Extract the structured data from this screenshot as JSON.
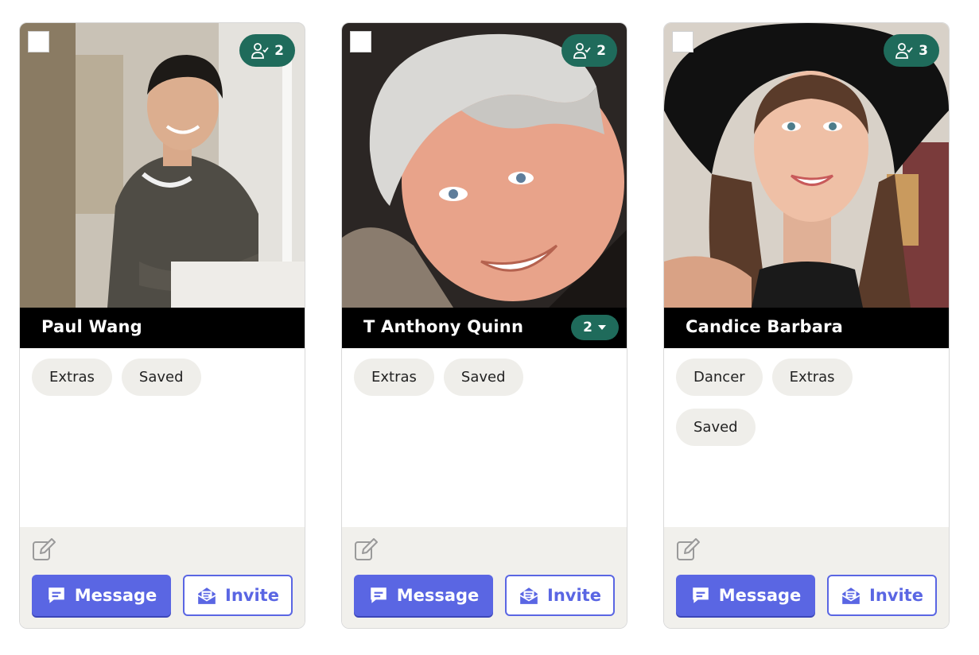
{
  "accent_color": "#5a66e3",
  "badge_color": "#1f6b5b",
  "cards": [
    {
      "name": "Paul Wang",
      "match_count": "2",
      "duplicate_count": "",
      "tags": [
        "Extras",
        "Saved"
      ],
      "message_label": "Message",
      "invite_label": "Invite"
    },
    {
      "name": "T Anthony Quinn",
      "match_count": "2",
      "duplicate_count": "2",
      "tags": [
        "Extras",
        "Saved"
      ],
      "message_label": "Message",
      "invite_label": "Invite"
    },
    {
      "name": "Candice Barbara",
      "match_count": "3",
      "duplicate_count": "",
      "tags": [
        "Dancer",
        "Extras",
        "Saved"
      ],
      "message_label": "Message",
      "invite_label": "Invite"
    }
  ]
}
